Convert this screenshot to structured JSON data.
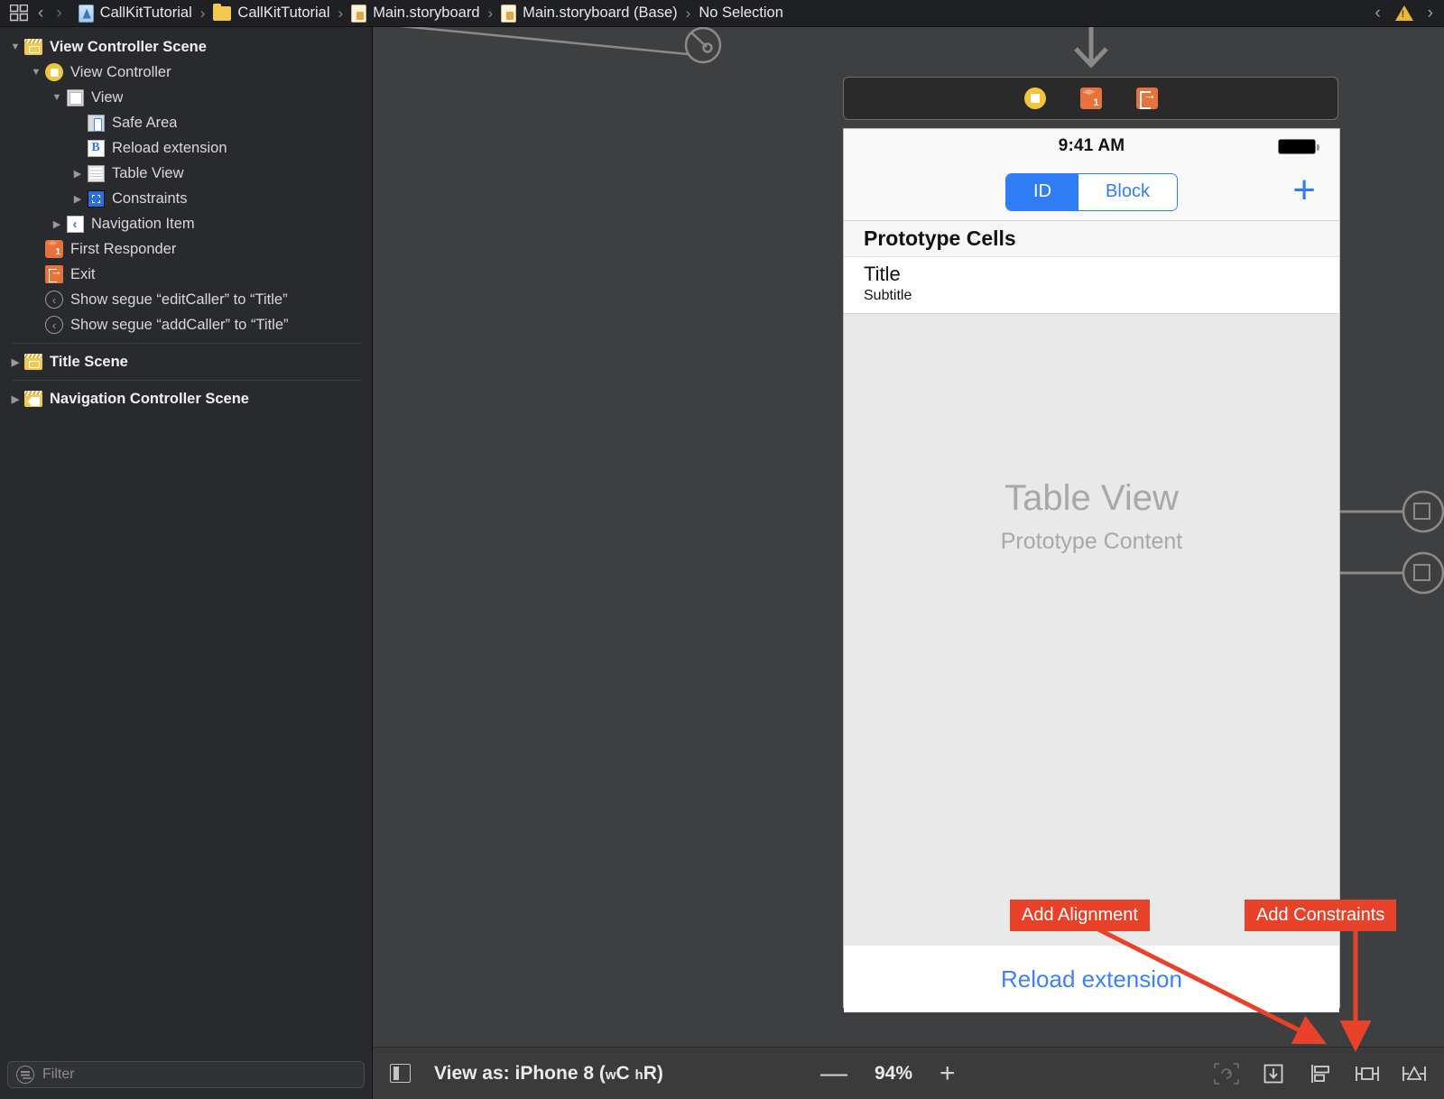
{
  "jumpbar": {
    "grid_icon": "grid-icon",
    "back_icon": "chevron-left-icon",
    "forward_icon": "chevron-right-icon",
    "breadcrumbs": [
      {
        "label": "CallKitTutorial",
        "icon": "swift-project-icon"
      },
      {
        "label": "CallKitTutorial",
        "icon": "folder-icon"
      },
      {
        "label": "Main.storyboard",
        "icon": "storyboard-icon"
      },
      {
        "label": "Main.storyboard (Base)",
        "icon": "storyboard-icon"
      },
      {
        "label": "No Selection",
        "icon": ""
      }
    ],
    "separator": "›",
    "right": {
      "prev_issue_icon": "chevron-left-icon",
      "warning_icon": "warning-triangle-icon",
      "next_issue_icon": "chevron-right-icon"
    }
  },
  "outline": {
    "groups": [
      {
        "rows": [
          {
            "label": "View Controller Scene",
            "icon": "scene-icon",
            "indent": 0,
            "disclosure": "open",
            "bold": true
          },
          {
            "label": "View Controller",
            "icon": "view-controller-icon",
            "indent": 1,
            "disclosure": "open",
            "bold": false
          },
          {
            "label": "View",
            "icon": "view-icon",
            "indent": 2,
            "disclosure": "open",
            "bold": false
          },
          {
            "label": "Safe Area",
            "icon": "safe-area-icon",
            "indent": 3,
            "disclosure": "none",
            "bold": false
          },
          {
            "label": "Reload extension",
            "icon": "button-icon",
            "indent": 3,
            "disclosure": "none",
            "bold": false
          },
          {
            "label": "Table View",
            "icon": "table-view-icon",
            "indent": 3,
            "disclosure": "closed",
            "bold": false
          },
          {
            "label": "Constraints",
            "icon": "constraints-icon",
            "indent": 3,
            "disclosure": "closed",
            "bold": false
          },
          {
            "label": "Navigation Item",
            "icon": "navigation-item-icon",
            "indent": 2,
            "disclosure": "closed",
            "bold": false
          },
          {
            "label": "First Responder",
            "icon": "first-responder-icon",
            "indent": 1,
            "disclosure": "none",
            "bold": false
          },
          {
            "label": "Exit",
            "icon": "exit-icon",
            "indent": 1,
            "disclosure": "none",
            "bold": false
          },
          {
            "label": "Show segue “editCaller” to “Title”",
            "icon": "segue-icon",
            "indent": 1,
            "disclosure": "none",
            "bold": false
          },
          {
            "label": "Show segue “addCaller” to “Title”",
            "icon": "segue-icon",
            "indent": 1,
            "disclosure": "none",
            "bold": false
          }
        ]
      },
      {
        "rows": [
          {
            "label": "Title Scene",
            "icon": "scene-icon",
            "indent": 0,
            "disclosure": "closed",
            "bold": true
          }
        ]
      },
      {
        "rows": [
          {
            "label": "Navigation Controller Scene",
            "icon": "nav-scene-icon",
            "indent": 0,
            "disclosure": "closed",
            "bold": true
          }
        ]
      }
    ],
    "filter": {
      "placeholder": "Filter",
      "value": "",
      "icon": "filter-icon"
    }
  },
  "canvas": {
    "scene_dock": {
      "items": [
        {
          "icon": "view-controller-icon",
          "name": "View Controller"
        },
        {
          "icon": "first-responder-icon",
          "name": "First Responder"
        },
        {
          "icon": "exit-icon",
          "name": "Exit"
        }
      ]
    },
    "device": {
      "status_bar": {
        "time": "9:41 AM",
        "battery_icon": "battery-full-icon"
      },
      "nav_bar": {
        "segmented": {
          "options": [
            "ID",
            "Block"
          ],
          "selected": "ID"
        },
        "add_button_icon": "plus-icon"
      },
      "table": {
        "section_header": "Prototype Cells",
        "prototype_cell": {
          "title": "Title",
          "subtitle": "Subtitle"
        },
        "placeholder_title": "Table View",
        "placeholder_subtitle": "Prototype Content"
      },
      "footer_button": "Reload extension"
    },
    "annotations": [
      {
        "label": "Add Alignment"
      },
      {
        "label": "Add Constraints"
      }
    ]
  },
  "bottom_bar": {
    "panel_toggle_icon": "left-panel-toggle-icon",
    "view_as_prefix": "View as: iPhone 8 (",
    "view_as_w": "w",
    "view_as_wc": "C",
    "view_as_h": "h",
    "view_as_hr": "R)",
    "zoom_out": "—",
    "zoom_level": "94%",
    "zoom_in": "+",
    "ib_buttons": [
      {
        "icon": "update-frames-icon",
        "enabled": false
      },
      {
        "icon": "embed-in-icon",
        "enabled": true
      },
      {
        "icon": "align-icon",
        "enabled": true
      },
      {
        "icon": "add-new-constraints-icon",
        "enabled": true
      },
      {
        "icon": "resolve-auto-layout-issues-icon",
        "enabled": true
      }
    ]
  },
  "colors": {
    "accent_red": "#e8422a",
    "ios_blue": "#2f7df6",
    "scene_yellow": "#f4c84e",
    "orange": "#e8723c",
    "warning_yellow": "#eab833"
  }
}
